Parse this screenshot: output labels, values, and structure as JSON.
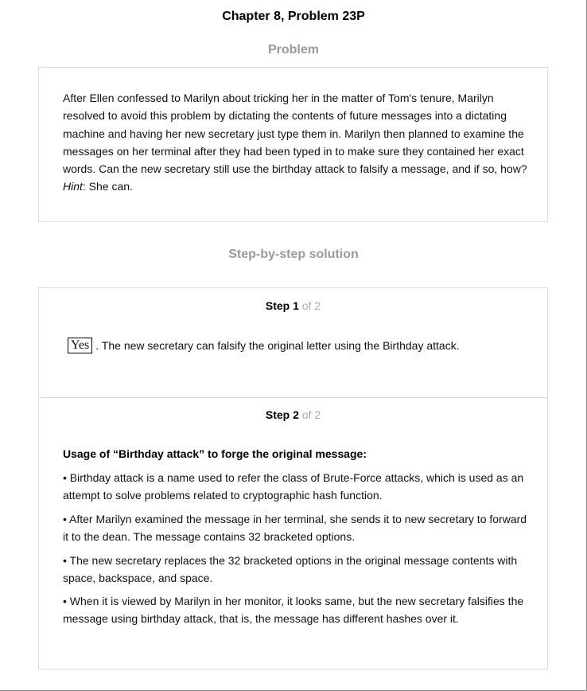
{
  "header": {
    "title": "Chapter 8, Problem 23P"
  },
  "problem": {
    "heading": "Problem",
    "text_before_hint": "After Ellen confessed to Marilyn about tricking her in the matter of Tom's tenure, Marilyn resolved to avoid this problem by dictating the contents of future messages into a dictating machine and having her new secretary just type them in. Marilyn then planned to examine the messages on her terminal after they had been typed in to make sure they contained her exact words. Can the new secretary still use the birthday attack to falsify a message, and if so, how? ",
    "hint_label": "Hint",
    "hint_text": ": She can."
  },
  "solution": {
    "heading": "Step-by-step solution",
    "steps": [
      {
        "label": "Step 1",
        "of": "of 2",
        "answer": "Yes",
        "text": ". The new secretary can falsify the original letter using the Birthday attack."
      },
      {
        "label": "Step 2",
        "of": "of 2",
        "subheading": "Usage of “Birthday attack” to forge the original message:",
        "bullets": [
          "• Birthday attack is a name used to refer the class of Brute-Force attacks, which is used as an attempt to solve problems related to cryptographic hash function.",
          "• After Marilyn examined the message in her terminal, she sends it to new secretary to forward it to the dean. The message contains 32 bracketed options.",
          "• The new secretary replaces the 32 bracketed options in the original message contents with space, backspace, and space.",
          "• When it is viewed by Marilyn in her monitor, it looks same, but the new secretary falsifies the message using birthday attack, that is, the message has different hashes over it."
        ]
      }
    ]
  }
}
